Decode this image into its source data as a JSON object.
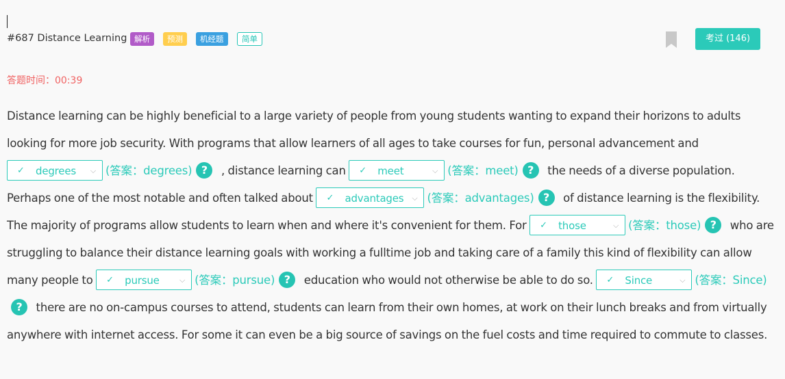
{
  "header": {
    "title": "#687 Distance Learning",
    "tags": [
      {
        "label": "解析",
        "color": "#b15bc8"
      },
      {
        "label": "预测",
        "color": "#ffce4e"
      },
      {
        "label": "机经题",
        "color": "#3aa0e0"
      },
      {
        "label": "简单",
        "color": "#24c4b6"
      }
    ],
    "done_button": "考过 (146)",
    "bookmark_icon": "bookmark-icon"
  },
  "timer": "答题时间：00:39",
  "passage": {
    "seg0": "Distance learning can be highly beneficial to a large variety of people from young students wanting to expand their horizons to adults looking for more job security. With programs that allow learners of all ages to take courses for fun, personal advancement and ",
    "seg1": " , distance learning can ",
    "seg2": " the needs of a diverse population. Perhaps one of the most notable and often talked about ",
    "seg3": " of distance learning is the flexibility. The majority of programs allow students to learn when and where it's convenient for them. For ",
    "seg4": " who are struggling to balance their distance learning goals with working a fulltime job and taking care of a family this kind of flexibility can allow many people to ",
    "seg5": " education who would not otherwise be able to do so. ",
    "seg6": " there are no on-campus courses to attend, students can learn from their own homes, at work on their lunch breaks and from virtually anywhere with internet access. For some it can even be a big source of savings on the fuel costs and time required to commute to classes.",
    "blanks": [
      {
        "value": "degrees",
        "answer": "(答案：degrees)"
      },
      {
        "value": "meet",
        "answer": "(答案：meet)"
      },
      {
        "value": "advantages",
        "answer": "(答案：advantages)"
      },
      {
        "value": "those",
        "answer": "(答案：those)"
      },
      {
        "value": "pursue",
        "answer": "(答案：pursue)"
      },
      {
        "value": "Since",
        "answer": "(答案：Since)"
      }
    ],
    "check_glyph": "✓",
    "chevron_glyph": "⌵",
    "help_glyph": "?"
  }
}
